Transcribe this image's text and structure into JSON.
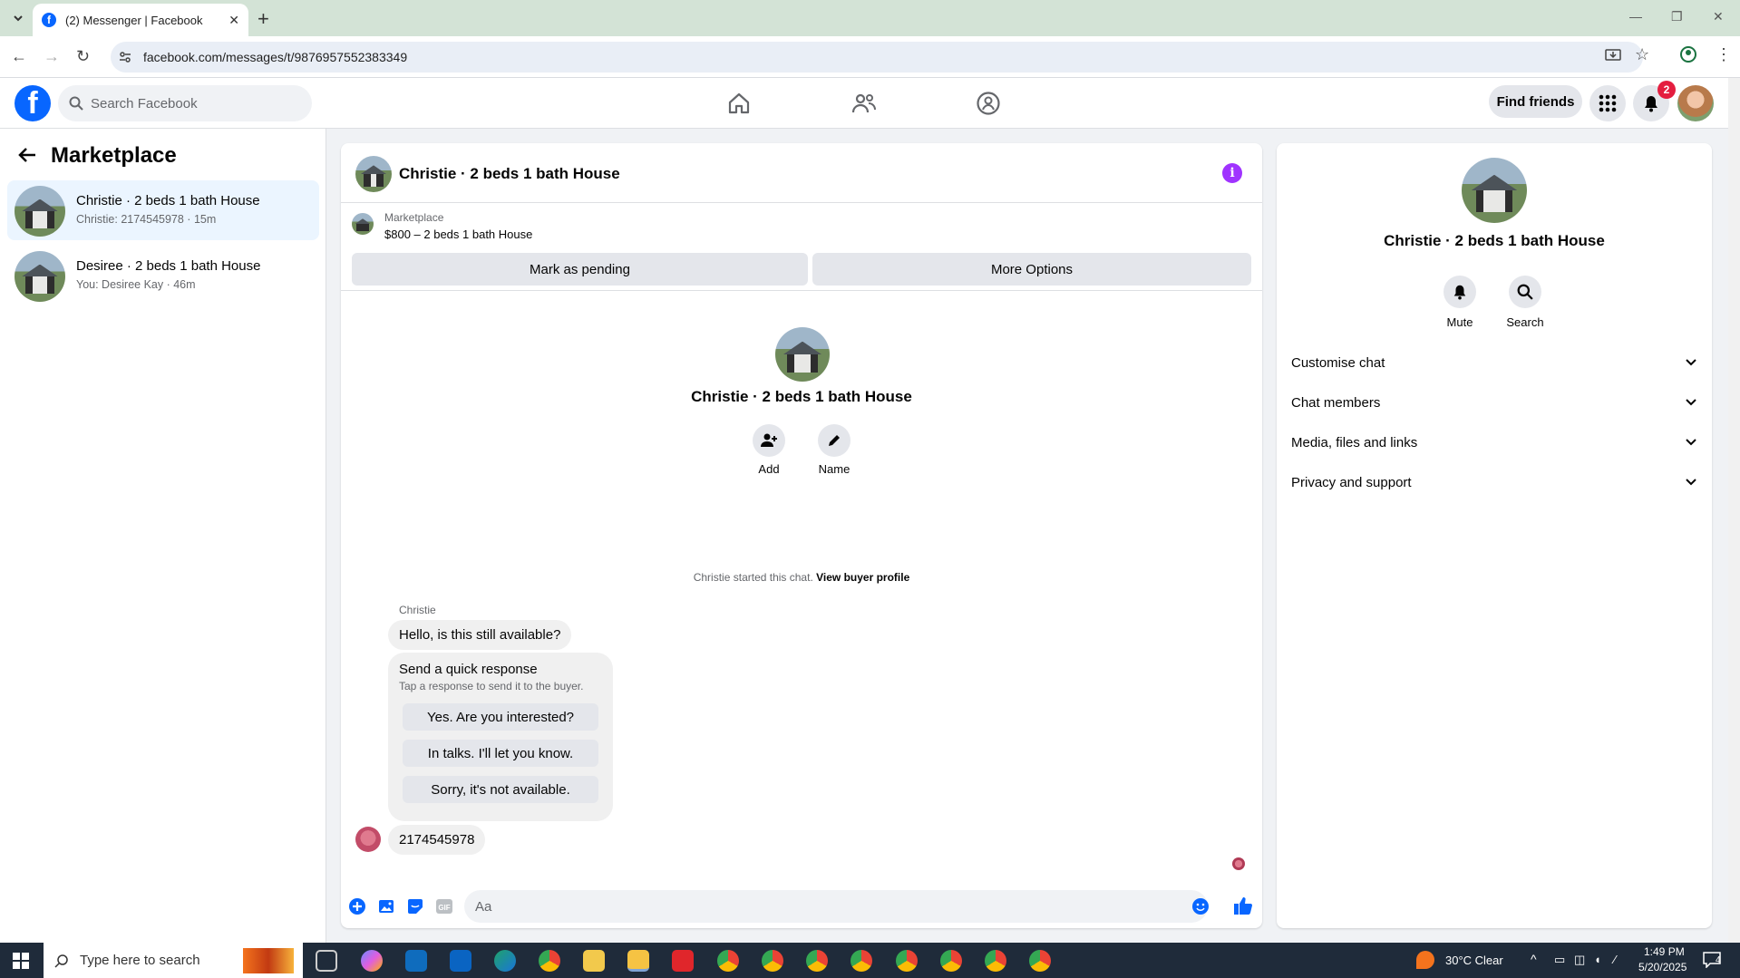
{
  "browser": {
    "tab_title": "(2) Messenger | Facebook",
    "url": "facebook.com/messages/t/9876957552383349"
  },
  "fb": {
    "search_placeholder": "Search Facebook",
    "find_friends": "Find friends",
    "notification_count": "2"
  },
  "sidebar": {
    "title": "Marketplace",
    "conversations": [
      {
        "name": "Christie · 2 beds 1 bath House",
        "preview": "Christie: 2174545978 · 15m"
      },
      {
        "name": "Desiree · 2 beds 1 bath House",
        "preview": "You: Desiree Kay · 46m"
      }
    ]
  },
  "chat": {
    "title": "Christie · 2 beds 1 bath House",
    "listing_label": "Marketplace",
    "listing_price": "$800 – 2 beds 1 bath House",
    "mark_pending": "Mark as pending",
    "more_options": "More Options",
    "center_name": "Christie · 2 beds 1 bath House",
    "add_label": "Add",
    "name_label": "Name",
    "started_text": "Christie started this chat.",
    "view_buyer_profile": "View buyer profile",
    "sender": "Christie",
    "message1": "Hello, is this still available?",
    "quick_title": "Send a quick response",
    "quick_sub": "Tap a response to send it to the buyer.",
    "quick_responses": [
      "Yes. Are you interested?",
      "In talks. I'll let you know.",
      "Sorry, it's not available."
    ],
    "my_message": "2174545978",
    "composer_placeholder": "Aa"
  },
  "details": {
    "name": "Christie · 2 beds 1 bath House",
    "mute": "Mute",
    "search": "Search",
    "sections": [
      "Customise chat",
      "Chat members",
      "Media, files and links",
      "Privacy and support"
    ]
  },
  "taskbar": {
    "search_placeholder": "Type here to search",
    "weather": "30°C  Clear",
    "time": "1:49 PM",
    "date": "5/20/2025",
    "notif_count": "4"
  },
  "colors": {
    "brand": "#0866ff",
    "accent_purple": "#a033ff"
  }
}
